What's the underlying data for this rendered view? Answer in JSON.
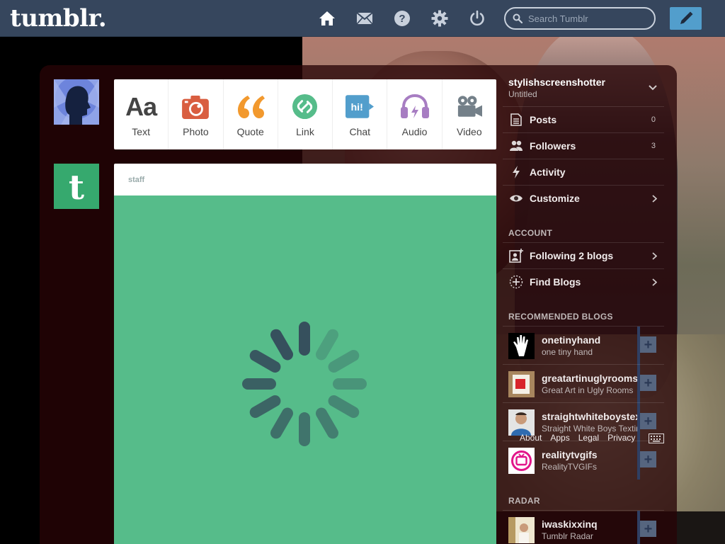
{
  "topbar": {
    "logo": "tumblr.",
    "search_placeholder": "Search Tumblr",
    "icons": [
      "home-icon",
      "mail-icon",
      "help-icon",
      "gear-icon",
      "power-icon",
      "pencil-icon"
    ]
  },
  "colors": {
    "topbar": "#36465d",
    "compose": "#529ecc",
    "post_green": "#56bc8a",
    "photo": "#d95e40",
    "quote": "#f2992e",
    "link": "#56bc8a",
    "chat": "#529ecc",
    "audio": "#a77dc2",
    "video": "#748089"
  },
  "post_types": [
    {
      "label": "Text",
      "glyph": "Aa"
    },
    {
      "label": "Photo"
    },
    {
      "label": "Quote"
    },
    {
      "label": "Link"
    },
    {
      "label": "Chat",
      "glyph": "hi!"
    },
    {
      "label": "Audio"
    },
    {
      "label": "Video"
    }
  ],
  "post": {
    "author": "staff"
  },
  "sidebar": {
    "blog_name": "stylishscreenshotter",
    "blog_title": "Untitled",
    "items": [
      {
        "label": "Posts",
        "count": "0"
      },
      {
        "label": "Followers",
        "count": "3"
      },
      {
        "label": "Activity"
      },
      {
        "label": "Customize"
      }
    ],
    "account_header": "ACCOUNT",
    "account_items": [
      {
        "label": "Following 2 blogs"
      },
      {
        "label": "Find Blogs"
      }
    ],
    "recommended_header": "RECOMMENDED BLOGS",
    "recommended": [
      {
        "name": "onetinyhand",
        "title": "one tiny hand"
      },
      {
        "name": "greatartinuglyrooms",
        "title": "Great Art in Ugly Rooms"
      },
      {
        "name": "straightwhiteboystexting",
        "title": "Straight White Boys Texting"
      },
      {
        "name": "realitytvgifs",
        "title": "RealityTVGIFs"
      }
    ],
    "footer_links": [
      "About",
      "Apps",
      "Legal",
      "Privacy"
    ],
    "radar_header": "RADAR",
    "radar": {
      "name": "iwaskixxinq",
      "title": "Tumblr Radar"
    }
  }
}
